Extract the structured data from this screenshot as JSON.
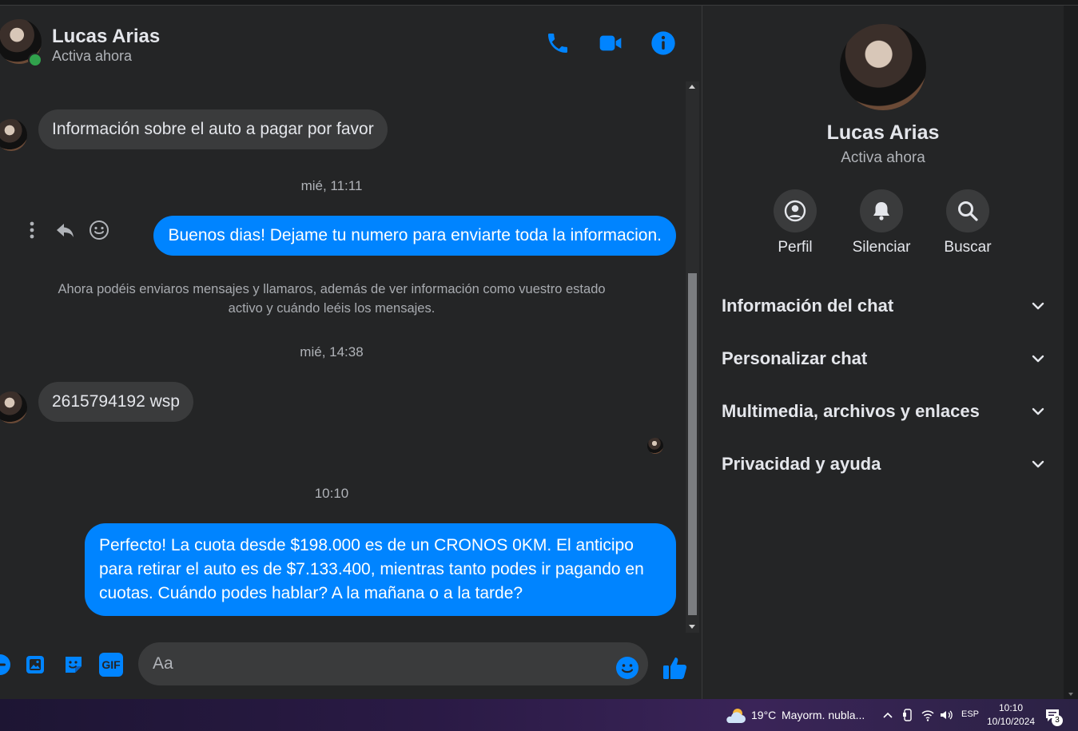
{
  "contact": {
    "name": "Lucas Arias",
    "status": "Activa ahora"
  },
  "header_icons": [
    "phone-icon",
    "video-icon",
    "info-icon"
  ],
  "messages": {
    "m1": "Información sobre el auto a pagar por favor",
    "t1": "mié, 11:11",
    "m2": "Buenos dias! Dejame tu numero para enviarte toda la informacion.",
    "notice": "Ahora podéis enviaros mensajes y llamaros, además de ver información como vuestro estado activo y cuándo leéis los mensajes.",
    "t2": "mié, 14:38",
    "m3": "2615794192 wsp",
    "t3": "10:10",
    "m4": "Perfecto! La cuota desde $198.000 es de un CRONOS 0KM. El anticipo para retirar el auto es de $7.133.400, mientras tanto podes ir pagando en cuotas. Cuándo podes hablar? A la mañana o a la tarde?"
  },
  "composer": {
    "placeholder": "Aa",
    "gif_label": "GIF"
  },
  "panel": {
    "actions": [
      {
        "label": "Perfil",
        "icon": "profile-icon"
      },
      {
        "label": "Silenciar",
        "icon": "bell-icon"
      },
      {
        "label": "Buscar",
        "icon": "search-icon"
      }
    ],
    "sections": [
      "Información del chat",
      "Personalizar chat",
      "Multimedia, archivos y enlaces",
      "Privacidad y ayuda"
    ]
  },
  "taskbar": {
    "weather": "19°C",
    "weather_text": "Mayorm. nubla...",
    "lang": "ESP",
    "time": "10:10",
    "date": "10/10/2024",
    "notifications": "3"
  },
  "colors": {
    "accent": "#0084ff",
    "background": "#242526",
    "bubble_in": "#3a3b3c",
    "online": "#31a24c"
  }
}
